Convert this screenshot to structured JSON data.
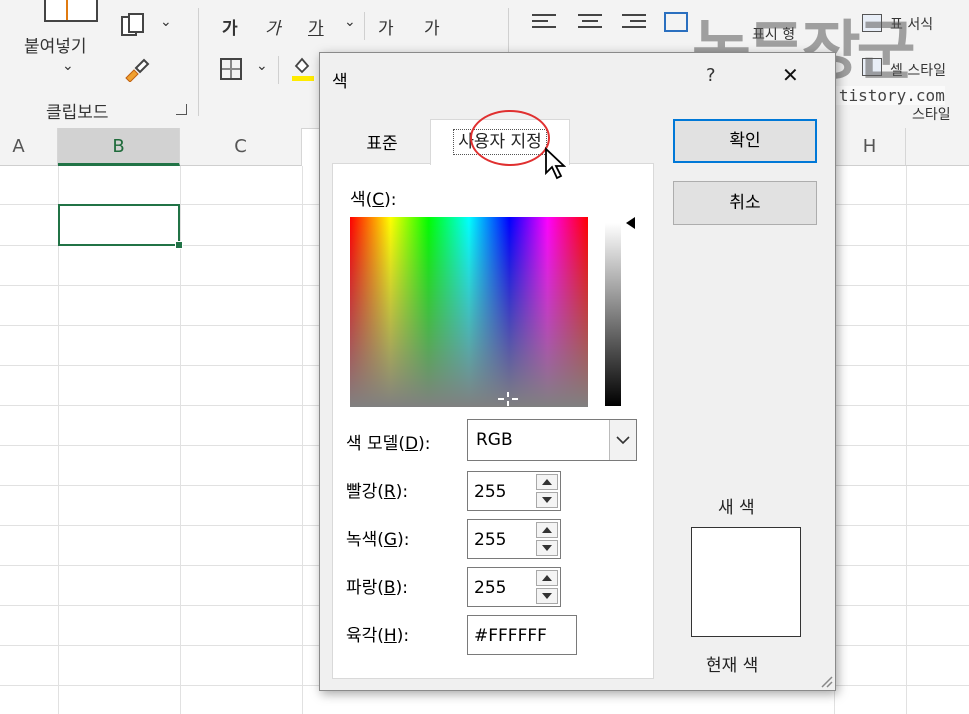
{
  "ribbon": {
    "paste_label": "붙여넣기",
    "clipboard_group": "클립보드",
    "bold_glyph": "가",
    "italic_glyph": "가",
    "underline_glyph": "가",
    "increase_font_glyph": "가",
    "decrease_font_glyph": "가",
    "conditional_format_label": "표시 형",
    "format_table_label": "표 서식",
    "cell_style_label": "셀 스타일",
    "styles_group": "스타일"
  },
  "watermark": {
    "text": "녹두장군",
    "url": "http://mainia.tistory.com"
  },
  "sheet": {
    "columns": [
      "A",
      "B",
      "C",
      "H"
    ],
    "selected_column": "B"
  },
  "dialog": {
    "title": "색",
    "help_glyph": "?",
    "close_glyph": "✕",
    "tabs": [
      {
        "label": "표준",
        "active": false
      },
      {
        "label": "사용자 지정",
        "active": true
      }
    ],
    "color_label": "색(",
    "color_accel": "C",
    "color_tail": "):",
    "model_label": "색 모델(",
    "model_accel": "D",
    "model_tail": "):",
    "model_value": "RGB",
    "red_label": "빨강(",
    "red_accel": "R",
    "red_tail": "):",
    "red_value": "255",
    "green_label": "녹색(",
    "green_accel": "G",
    "green_tail": "):",
    "green_value": "255",
    "blue_label": "파랑(",
    "blue_accel": "B",
    "blue_tail": "):",
    "blue_value": "255",
    "hex_label": "육각(",
    "hex_accel": "H",
    "hex_tail": "):",
    "hex_value": "#FFFFFF",
    "ok_label": "확인",
    "cancel_label": "취소",
    "new_color_label": "새 색",
    "current_color_label": "현재 색",
    "new_color_value": "#FFFFFF",
    "highlight_color": "#e03030"
  }
}
